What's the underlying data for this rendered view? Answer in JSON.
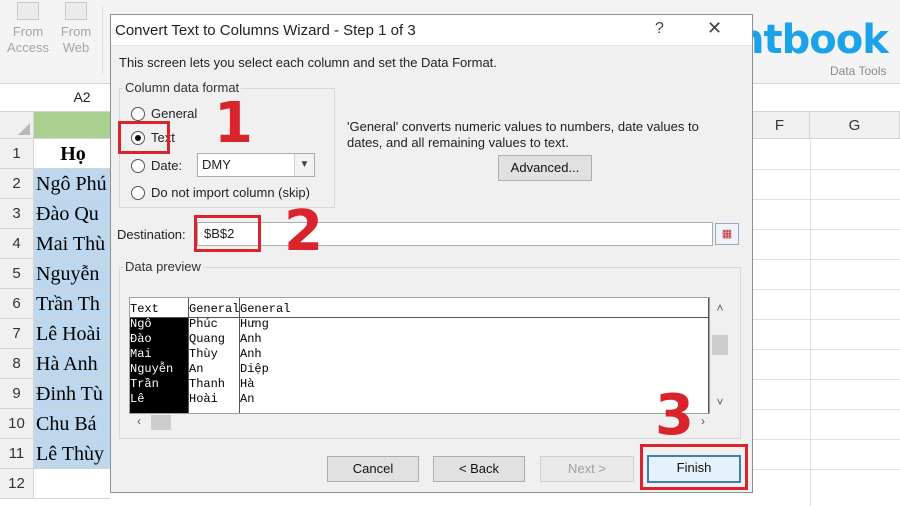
{
  "ribbon": {
    "buttons": [
      {
        "label_1": "From",
        "label_2": "Access"
      },
      {
        "label_1": "From",
        "label_2": "Web"
      }
    ],
    "group_label": "Data Tools"
  },
  "brand": {
    "logo_text": "ntbook",
    "accent": "#1aa3e8"
  },
  "name_box": "A2",
  "columns": [
    "F",
    "G"
  ],
  "rows": [
    {
      "num": "1",
      "name": "Họ"
    },
    {
      "num": "2",
      "name": "Ngô Phú"
    },
    {
      "num": "3",
      "name": "Đào Qu"
    },
    {
      "num": "4",
      "name": "Mai Thù"
    },
    {
      "num": "5",
      "name": "Nguyễn"
    },
    {
      "num": "6",
      "name": "Trần Th"
    },
    {
      "num": "7",
      "name": "Lê Hoài"
    },
    {
      "num": "8",
      "name": "Hà Anh"
    },
    {
      "num": "9",
      "name": "Đinh Tù"
    },
    {
      "num": "10",
      "name": "Chu Bá"
    },
    {
      "num": "11",
      "name": "Lê Thùy"
    },
    {
      "num": "12",
      "name": ""
    }
  ],
  "dialog": {
    "title": "Convert Text to Columns Wizard - Step 1 of 3",
    "help": "?",
    "close": "✕",
    "intro": "This screen lets you select each column and set the Data Format.",
    "format_group": "Column data format",
    "options": {
      "general": "General",
      "text": "Text",
      "date": "Date:",
      "skip": "Do not import column (skip)"
    },
    "selected_option": "text",
    "date_format": "DMY",
    "description": "'General' converts numeric values to numbers, date values to dates, and all remaining values to text.",
    "advanced": "Advanced...",
    "destination_label": "Destination:",
    "destination_value": "$B$2",
    "preview_label": "Data preview",
    "preview": {
      "headers": [
        "Text",
        "General",
        "General"
      ],
      "col1": [
        "Ngô",
        "Đào",
        "Mai",
        "Nguyễn",
        "Trần",
        "Lê"
      ],
      "col2": [
        "Phúc",
        "Quang",
        "Thùy",
        "An",
        "Thanh",
        "Hoài"
      ],
      "col3": [
        "Hưng",
        "Anh",
        "Anh",
        "Diệp",
        "Hà",
        "An"
      ]
    },
    "buttons": {
      "cancel": "Cancel",
      "back": "< Back",
      "next": "Next >",
      "finish": "Finish"
    }
  },
  "annotations": {
    "step1": "1",
    "step2": "2",
    "step3": "3",
    "color": "#d9232d"
  }
}
